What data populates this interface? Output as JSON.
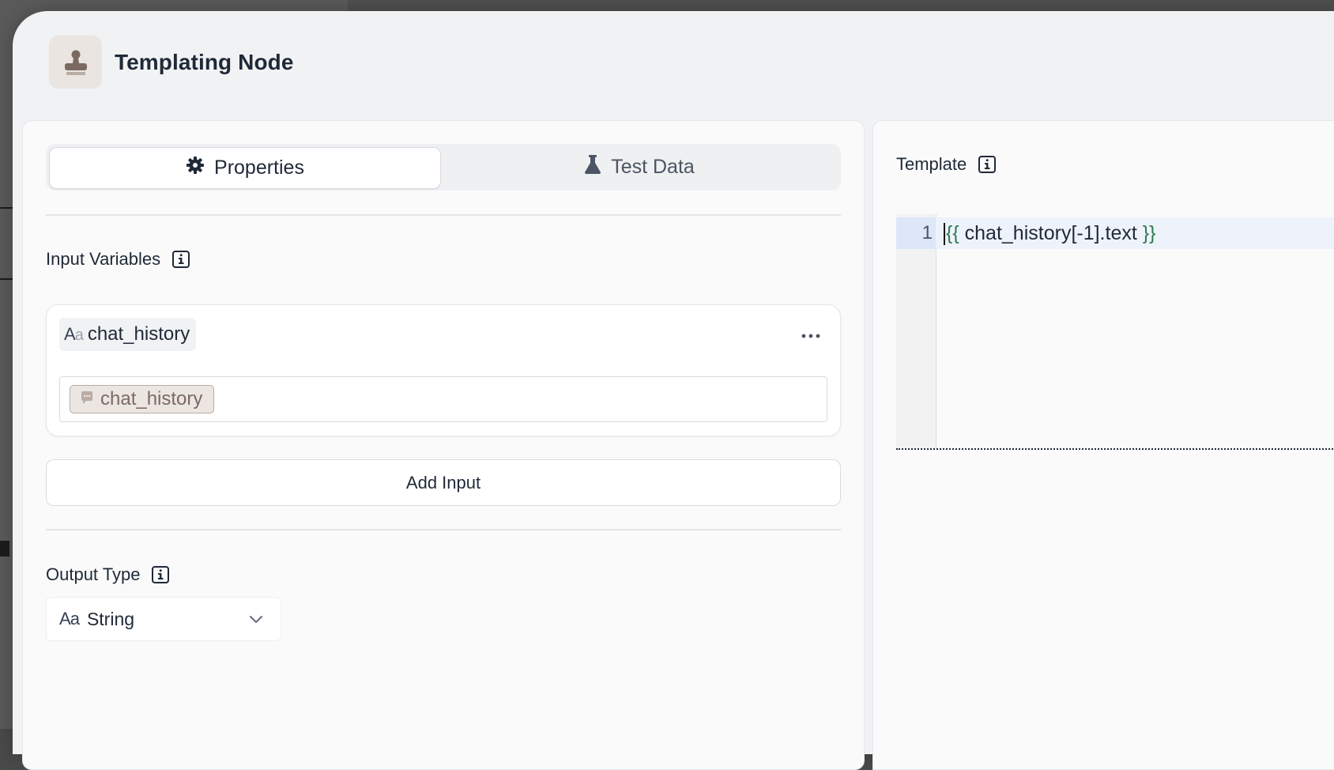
{
  "header": {
    "title": "Templating Node",
    "icon": "stamp-icon"
  },
  "tabs": [
    {
      "label": "Properties",
      "icon": "gear-icon",
      "active": true
    },
    {
      "label": "Test Data",
      "icon": "flask-icon",
      "active": false
    }
  ],
  "input_variables": {
    "label": "Input Variables",
    "items": [
      {
        "name": "chat_history",
        "type_icon": "Aa",
        "value_chip": "chat_history",
        "value_icon": "chat-bubble-icon"
      }
    ],
    "add_button": "Add Input"
  },
  "output_type": {
    "label": "Output Type",
    "type_icon": "Aa",
    "value": "String"
  },
  "template": {
    "label": "Template",
    "lines": [
      {
        "number": "1",
        "open": "{{",
        "expr": " chat_history[-1].text ",
        "close": "}}"
      }
    ]
  },
  "colors": {
    "accent_brown": "#7b6a61",
    "template_brace": "#2e7d4f",
    "panel_bg": "#fafafa"
  }
}
